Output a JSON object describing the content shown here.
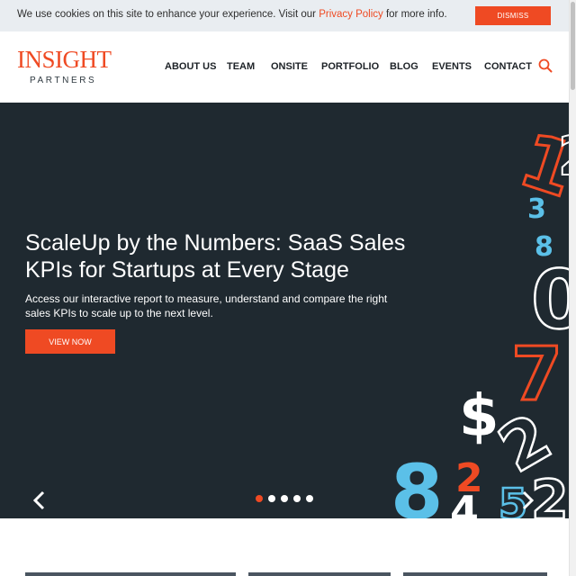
{
  "cookie_bar": {
    "text_before": "We use cookies on this site to enhance your experience. Visit our ",
    "link_text": "Privacy Policy",
    "text_after": " for more info.",
    "dismiss_label": "DISMISS"
  },
  "header": {
    "logo_main": "INSIGHT",
    "logo_sub": "PARTNERS",
    "nav": [
      "ABOUT US",
      "TEAM",
      "ONSITE",
      "PORTFOLIO",
      "BLOG",
      "EVENTS",
      "CONTACT"
    ],
    "search_icon": "search-icon"
  },
  "hero": {
    "title": "ScaleUp by the Numbers: SaaS Sales KPIs for Startups at Every Stage",
    "description": "Access our interactive report to measure, understand and compare the right sales KPIs to scale up to the next level.",
    "cta_label": "VIEW NOW",
    "slide_count": 5,
    "active_slide": 1
  },
  "colors": {
    "accent": "#ef4a23",
    "hero_bg": "#1f2930",
    "cookie_bg": "#e9edf1",
    "digit_blue": "#5bc0e8"
  }
}
